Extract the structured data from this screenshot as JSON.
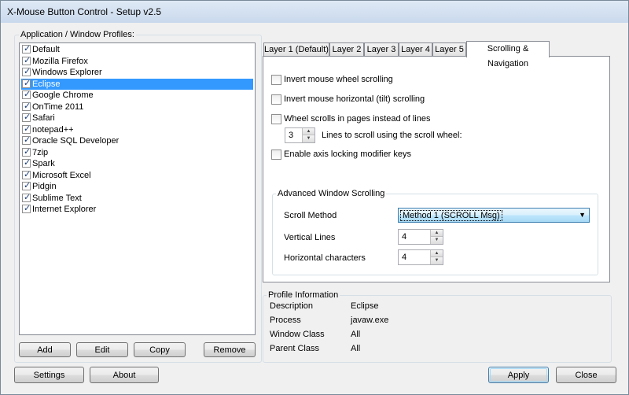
{
  "window": {
    "title": "X-Mouse Button Control - Setup v2.5"
  },
  "profiles": {
    "label": "Application / Window Profiles:",
    "items": [
      {
        "label": "Default",
        "checked": true
      },
      {
        "label": "Mozilla Firefox",
        "checked": true
      },
      {
        "label": "Windows Explorer",
        "checked": true
      },
      {
        "label": "Eclipse",
        "checked": true,
        "selected": true
      },
      {
        "label": "Google Chrome",
        "checked": true
      },
      {
        "label": "OnTime 2011",
        "checked": true
      },
      {
        "label": "Safari",
        "checked": true
      },
      {
        "label": "notepad++",
        "checked": true
      },
      {
        "label": "Oracle SQL Developer",
        "checked": true
      },
      {
        "label": "7zip",
        "checked": true
      },
      {
        "label": "Spark",
        "checked": true
      },
      {
        "label": "Microsoft Excel",
        "checked": true
      },
      {
        "label": "Pidgin",
        "checked": true
      },
      {
        "label": "Sublime Text",
        "checked": true
      },
      {
        "label": "Internet Explorer",
        "checked": true
      }
    ],
    "buttons": {
      "add": "Add",
      "edit": "Edit",
      "copy": "Copy",
      "remove": "Remove"
    }
  },
  "tabs": [
    {
      "label": "Layer 1 (Default)"
    },
    {
      "label": "Layer 2"
    },
    {
      "label": "Layer 3"
    },
    {
      "label": "Layer 4"
    },
    {
      "label": "Layer 5"
    },
    {
      "label": "Scrolling & Navigation",
      "active": true
    }
  ],
  "scrolling": {
    "invert_wheel": "Invert mouse wheel scrolling",
    "invert_tilt": "Invert mouse horizontal (tilt) scrolling",
    "wheel_pages": "Wheel scrolls in pages instead of lines",
    "lines_value": "3",
    "lines_label": "Lines to scroll using the scroll wheel:",
    "axis_locking": "Enable axis locking modifier keys"
  },
  "advanced": {
    "title": "Advanced Window Scrolling",
    "scroll_method_label": "Scroll Method",
    "scroll_method_value": "Method 1 (SCROLL Msg)",
    "vertical_lines_label": "Vertical Lines",
    "vertical_lines_value": "4",
    "horizontal_chars_label": "Horizontal characters",
    "horizontal_chars_value": "4"
  },
  "profile_info": {
    "title": "Profile Information",
    "rows": [
      {
        "label": "Description",
        "value": "Eclipse"
      },
      {
        "label": "Process",
        "value": "javaw.exe"
      },
      {
        "label": "Window Class",
        "value": "All"
      },
      {
        "label": "Parent Class",
        "value": "All"
      }
    ]
  },
  "footer": {
    "settings": "Settings",
    "about": "About",
    "apply": "Apply",
    "close": "Close"
  }
}
